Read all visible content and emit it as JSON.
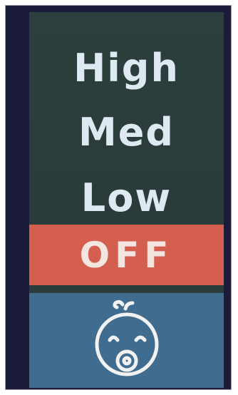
{
  "menu": {
    "items": [
      {
        "label": "High",
        "selected": false
      },
      {
        "label": "Med",
        "selected": false
      },
      {
        "label": "Low",
        "selected": false
      },
      {
        "label": "OFF",
        "selected": true
      }
    ]
  },
  "mode_icon": "baby-face-icon",
  "colors": {
    "screen_bg": "#2d3f3d",
    "selected_bg": "#d45f4e",
    "text": "#dfe9f2",
    "icon_panel_bg": "#3f6c8f"
  }
}
